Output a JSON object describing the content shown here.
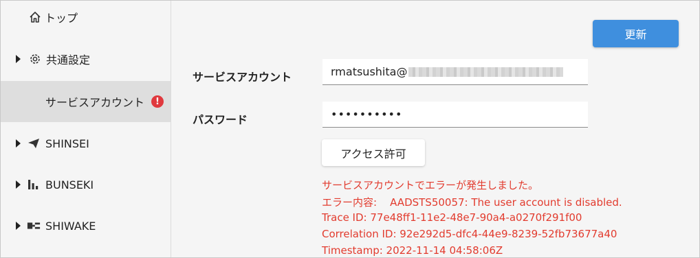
{
  "sidebar": {
    "items": [
      {
        "label": "トップ",
        "icon": "home-icon"
      },
      {
        "label": "共通設定",
        "icon": "gear-icon"
      },
      {
        "label": "サービスアカウント",
        "badge": "!"
      },
      {
        "label": "SHINSEI",
        "icon": "paper-plane-icon"
      },
      {
        "label": "BUNSEKI",
        "icon": "bar-chart-icon"
      },
      {
        "label": "SHIWAKE",
        "icon": "split-icon"
      }
    ]
  },
  "toolbar": {
    "update_label": "更新"
  },
  "form": {
    "service_account_label": "サービスアカウント",
    "service_account_value": "rmatsushita@",
    "password_label": "パスワード",
    "password_value": "••••••••••",
    "access_button_label": "アクセス許可"
  },
  "error": {
    "lines": [
      "サービスアカウントでエラーが発生しました。",
      "エラー内容:    AADSTS50057: The user account is disabled.",
      "Trace ID: 77e48ff1-11e2-48e7-90a4-a0270f291f00",
      "Correlation ID: 92e292d5-dfc4-44e9-8239-52fb73677a40",
      "Timestamp: 2022-11-14 04:58:06Z"
    ],
    "color": "#e23b2e"
  },
  "colors": {
    "accent": "#3f8fde",
    "active_bg": "#dedede",
    "alert": "#e0393e"
  }
}
